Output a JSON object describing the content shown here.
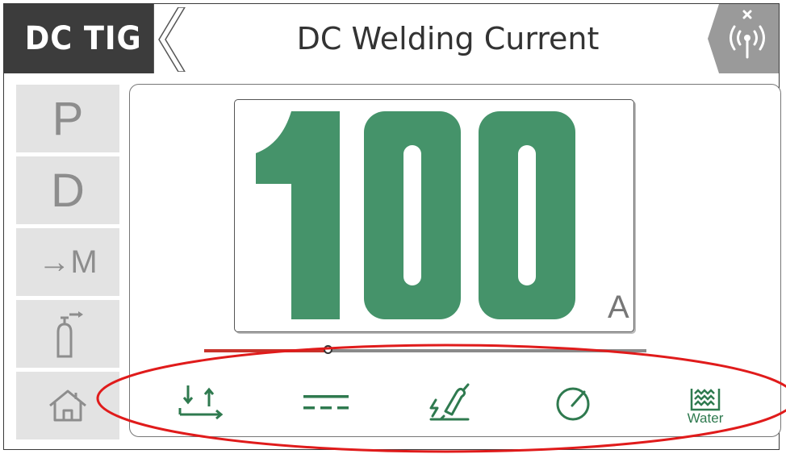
{
  "header": {
    "mode": "DC TIG",
    "title": "DC Welding Current"
  },
  "sidebar": {
    "items": [
      {
        "label": "P",
        "name": "program"
      },
      {
        "label": "D",
        "name": "display"
      },
      {
        "label": "→M",
        "name": "memory"
      },
      {
        "label": "",
        "name": "gas",
        "icon": "gas-bottle-icon"
      },
      {
        "label": "",
        "name": "home",
        "icon": "home-icon"
      }
    ]
  },
  "current": {
    "value": "100",
    "unit": "A",
    "slider_fraction": 0.28
  },
  "bottom_icons": [
    {
      "name": "trigger-mode-icon"
    },
    {
      "name": "dc-output-icon"
    },
    {
      "name": "torch-icon"
    },
    {
      "name": "gauge-icon"
    },
    {
      "name": "water-cooling-icon",
      "label": "Water"
    }
  ],
  "colors": {
    "value": "#45936a",
    "header_dark": "#3c3c3c",
    "annotation": "#e01b1b",
    "slider_fill": "#c8332b"
  }
}
